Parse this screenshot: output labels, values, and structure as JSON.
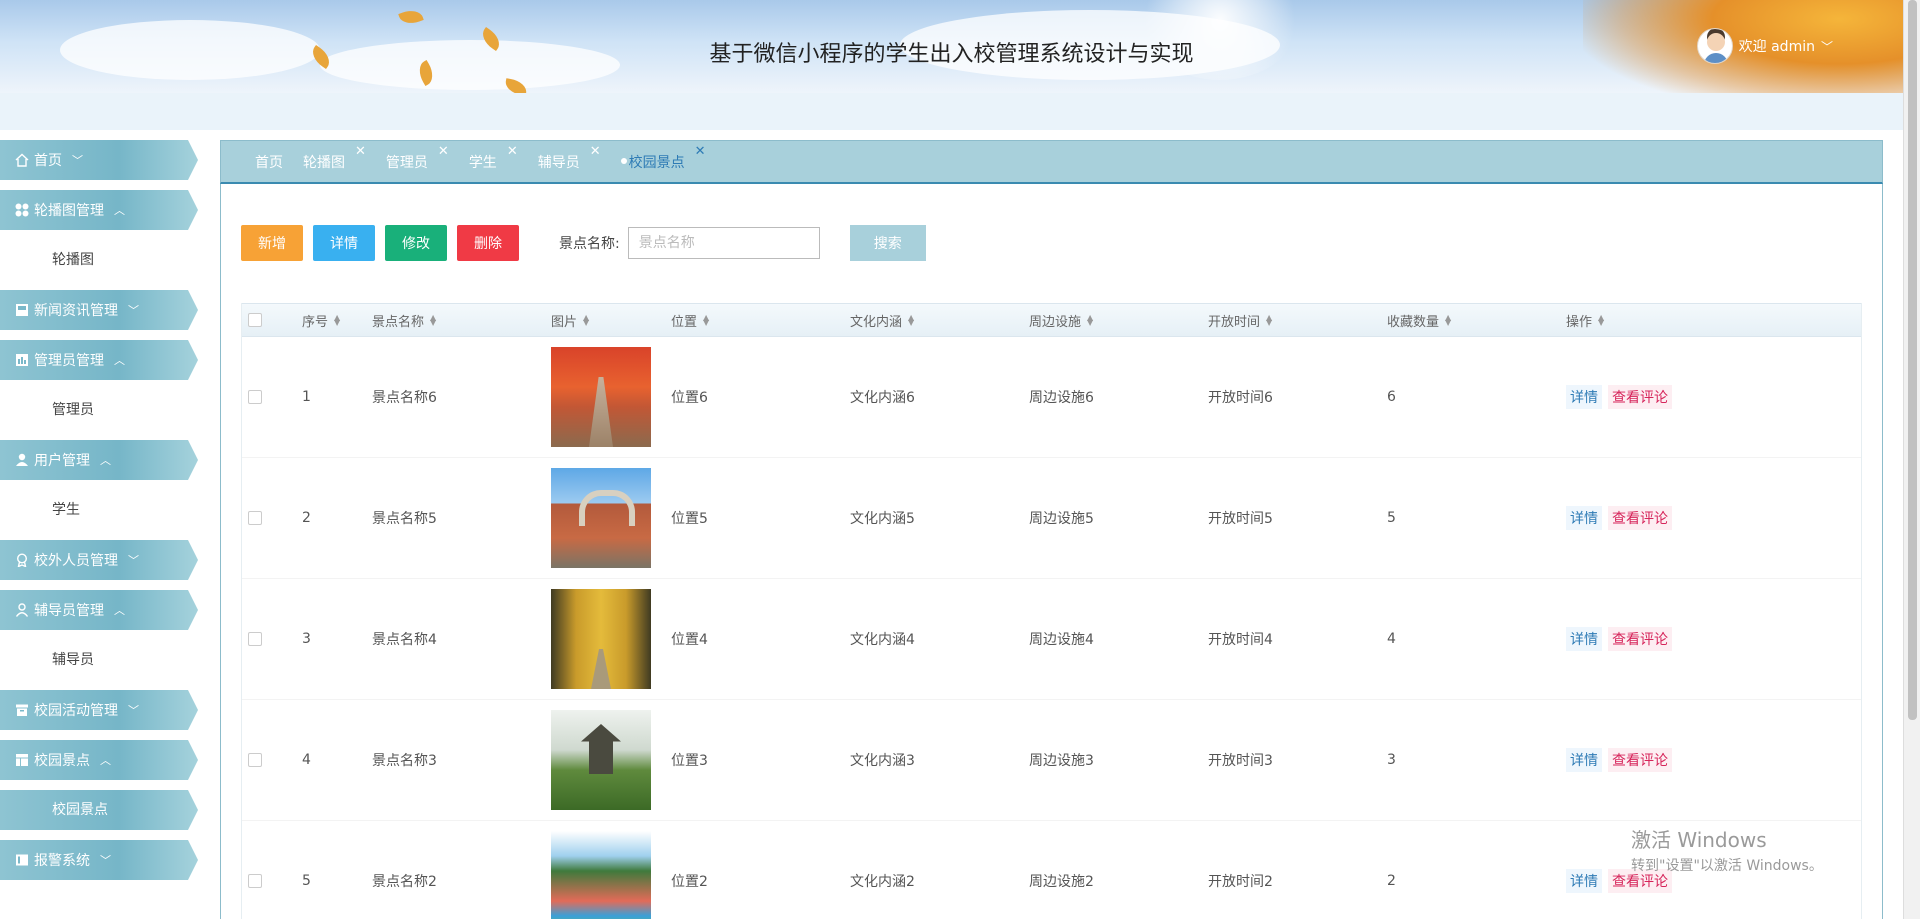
{
  "header": {
    "title": "基于微信小程序的学生出入校管理系统设计与实现",
    "user_label": "欢迎 admin"
  },
  "sidebar": {
    "items": [
      {
        "type": "menu",
        "label": "首页",
        "icon": "home-icon",
        "expanded": false
      },
      {
        "type": "menu",
        "label": "轮播图管理",
        "icon": "grid-icon",
        "expanded": true
      },
      {
        "type": "sub",
        "label": "轮播图",
        "active": false
      },
      {
        "type": "menu",
        "label": "新闻资讯管理",
        "icon": "news-icon",
        "expanded": false
      },
      {
        "type": "menu",
        "label": "管理员管理",
        "icon": "chart-icon",
        "expanded": true
      },
      {
        "type": "sub",
        "label": "管理员",
        "active": false
      },
      {
        "type": "menu",
        "label": "用户管理",
        "icon": "user-icon",
        "expanded": true
      },
      {
        "type": "sub",
        "label": "学生",
        "active": false
      },
      {
        "type": "menu",
        "label": "校外人员管理",
        "icon": "badge-icon",
        "expanded": false
      },
      {
        "type": "menu",
        "label": "辅导员管理",
        "icon": "person-icon",
        "expanded": true
      },
      {
        "type": "sub",
        "label": "辅导员",
        "active": false
      },
      {
        "type": "menu",
        "label": "校园活动管理",
        "icon": "archive-icon",
        "expanded": false
      },
      {
        "type": "menu",
        "label": "校园景点",
        "icon": "layout-icon",
        "expanded": true
      },
      {
        "type": "sub",
        "label": "校园景点",
        "active": true
      },
      {
        "type": "menu",
        "label": "报警系统",
        "icon": "panel-icon",
        "expanded": false
      }
    ]
  },
  "tabs": [
    {
      "label": "首页",
      "closable": false,
      "active": false
    },
    {
      "label": "轮播图",
      "closable": true,
      "active": false
    },
    {
      "label": "管理员",
      "closable": true,
      "active": false
    },
    {
      "label": "学生",
      "closable": true,
      "active": false
    },
    {
      "label": "辅导员",
      "closable": true,
      "active": false
    },
    {
      "label": "校园景点",
      "closable": true,
      "active": true
    }
  ],
  "toolbar": {
    "add_label": "新增",
    "detail_label": "详情",
    "edit_label": "修改",
    "delete_label": "删除",
    "search_label": "景点名称:",
    "search_placeholder": "景点名称",
    "search_button": "搜索"
  },
  "table": {
    "columns": [
      "序号",
      "景点名称",
      "图片",
      "位置",
      "文化内涵",
      "周边设施",
      "开放时间",
      "收藏数量",
      "操作"
    ],
    "rows": [
      {
        "idx": "1",
        "name": "景点名称6",
        "image": "scene-autumn",
        "pos": "位置6",
        "culture": "文化内涵6",
        "facility": "周边设施6",
        "time": "开放时间6",
        "fav": "6",
        "act_detail": "详情",
        "act_comment": "查看评论"
      },
      {
        "idx": "2",
        "name": "景点名称5",
        "image": "scene-building",
        "pos": "位置5",
        "culture": "文化内涵5",
        "facility": "周边设施5",
        "time": "开放时间5",
        "fav": "5",
        "act_detail": "详情",
        "act_comment": "查看评论"
      },
      {
        "idx": "3",
        "name": "景点名称4",
        "image": "scene-ginkgo",
        "pos": "位置4",
        "culture": "文化内涵4",
        "facility": "周边设施4",
        "time": "开放时间4",
        "fav": "4",
        "act_detail": "详情",
        "act_comment": "查看评论"
      },
      {
        "idx": "4",
        "name": "景点名称3",
        "image": "scene-pavilion",
        "pos": "位置3",
        "culture": "文化内涵3",
        "facility": "周边设施3",
        "time": "开放时间3",
        "fav": "3",
        "act_detail": "详情",
        "act_comment": "查看评论"
      },
      {
        "idx": "5",
        "name": "景点名称2",
        "image": "scene-track",
        "pos": "位置2",
        "culture": "文化内涵2",
        "facility": "周边设施2",
        "time": "开放时间2",
        "fav": "2",
        "act_detail": "详情",
        "act_comment": "查看评论"
      }
    ]
  },
  "watermark": {
    "line1": "激活 Windows",
    "line2": "转到\"设置\"以激活 Windows。"
  },
  "colors": {
    "accent": "#a8d0db",
    "sidebar": "#76b6c8",
    "add": "#f7a236",
    "detail": "#39b0f0",
    "edit": "#19b07a",
    "delete": "#f03a45"
  }
}
